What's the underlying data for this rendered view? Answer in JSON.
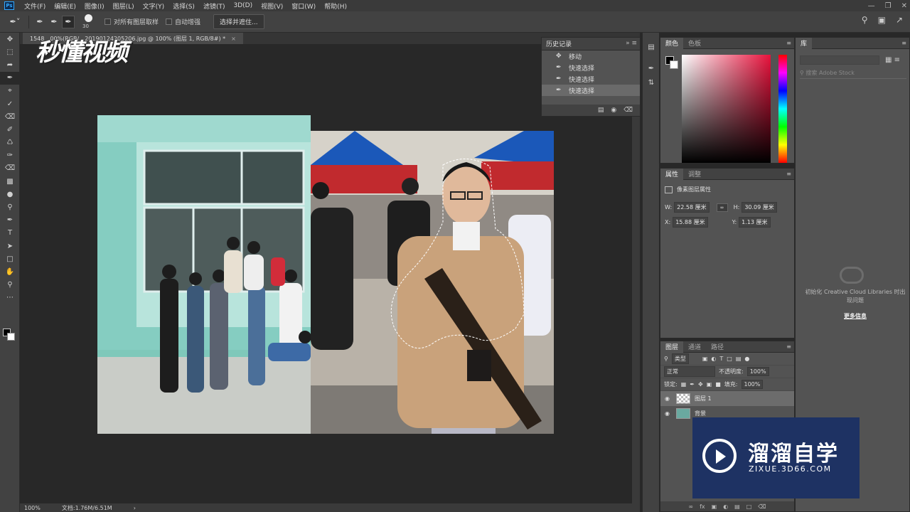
{
  "menubar": {
    "logo": "Ps",
    "items": [
      "文件(F)",
      "编辑(E)",
      "图像(I)",
      "图层(L)",
      "文字(Y)",
      "选择(S)",
      "滤镜(T)",
      "3D(D)",
      "视图(V)",
      "窗口(W)",
      "帮助(H)"
    ]
  },
  "options": {
    "brush_size": "30",
    "sample_all_layers": "对所有图层取样",
    "auto_enhance": "自动增强",
    "select_mask_button": "选择并遮住..."
  },
  "document": {
    "tab_title": "20190124205206.jpg @ 100% (图层 1, RGB/8#) *",
    "tab_prefix": "1548",
    "tab_hidden": "00%(RGB/",
    "zoom": "100%",
    "doc_size": "文档:1.76M/6.51M"
  },
  "watermark": {
    "top_left": "秒懂视频",
    "zixue_title": "溜溜自学",
    "zixue_url": "ZIXUE.3D66.COM"
  },
  "history": {
    "tab": "历史记录",
    "items": [
      {
        "icon": "move",
        "label": "移动"
      },
      {
        "icon": "quick-select",
        "label": "快速选择"
      },
      {
        "icon": "quick-select",
        "label": "快速选择"
      },
      {
        "icon": "quick-select",
        "label": "快速选择"
      }
    ]
  },
  "color_panel": {
    "tabs": [
      "颜色",
      "色板"
    ],
    "hue_color": "#e8123c"
  },
  "properties": {
    "tabs": [
      "属性",
      "调整"
    ],
    "title": "像素图层属性",
    "w_label": "W:",
    "w_value": "22.58 厘米",
    "h_label": "H:",
    "h_value": "30.09 厘米",
    "x_label": "X:",
    "x_value": "15.88 厘米",
    "y_label": "Y:",
    "y_value": "1.13 厘米"
  },
  "layers": {
    "tabs": [
      "图层",
      "通道",
      "路径"
    ],
    "filter_type": "类型",
    "blend_mode": "正常",
    "opacity_label": "不透明度:",
    "opacity_value": "100%",
    "lock_label": "锁定:",
    "fill_label": "填充:",
    "fill_value": "100%",
    "items": [
      {
        "name": "图层 1",
        "selected": true
      },
      {
        "name": "背景",
        "selected": false
      }
    ]
  },
  "library": {
    "tab": "库",
    "search_placeholder": "搜索 Adobe Stock",
    "message": "初始化 Creative Cloud Libraries 时出现问题",
    "more_info": "更多信息"
  }
}
